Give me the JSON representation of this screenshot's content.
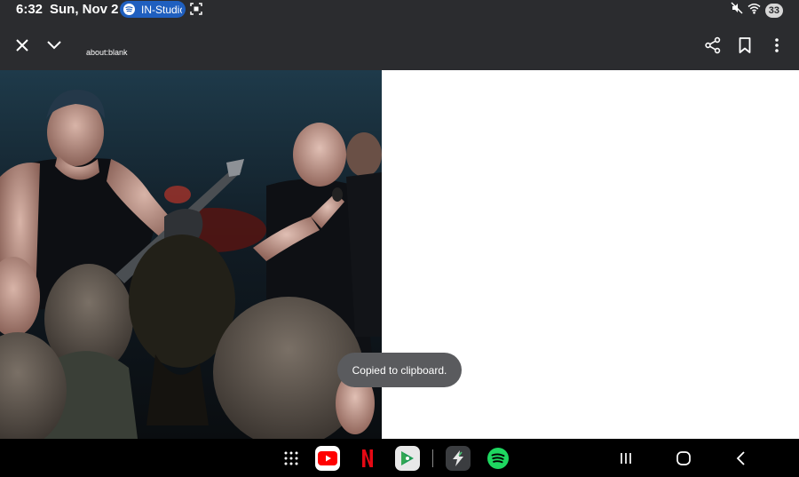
{
  "status": {
    "time": "6:32",
    "date": "Sun, Nov 2",
    "media_pill_text": "IN-Studio",
    "battery": "33"
  },
  "toolbar": {
    "url": "about:blank",
    "icons": [
      "close-icon",
      "chevron-down-icon",
      "share-icon",
      "bookmark-icon",
      "more-vert-icon"
    ]
  },
  "toast": {
    "message": "Copied to clipboard."
  },
  "taskbar": {
    "apps": [
      "app-drawer-icon",
      "youtube-icon",
      "netflix-icon",
      "play-games-icon",
      "bolt-app-icon",
      "spotify-icon"
    ],
    "nav": [
      "recents-icon",
      "home-icon",
      "back-icon"
    ]
  },
  "colors": {
    "bar": "#2b2c2f",
    "pill": "#1f5fbf",
    "toast": "#5a5b5e",
    "youtube": "#ff0000",
    "netflix": "#e50914",
    "spotify": "#1ed760"
  }
}
